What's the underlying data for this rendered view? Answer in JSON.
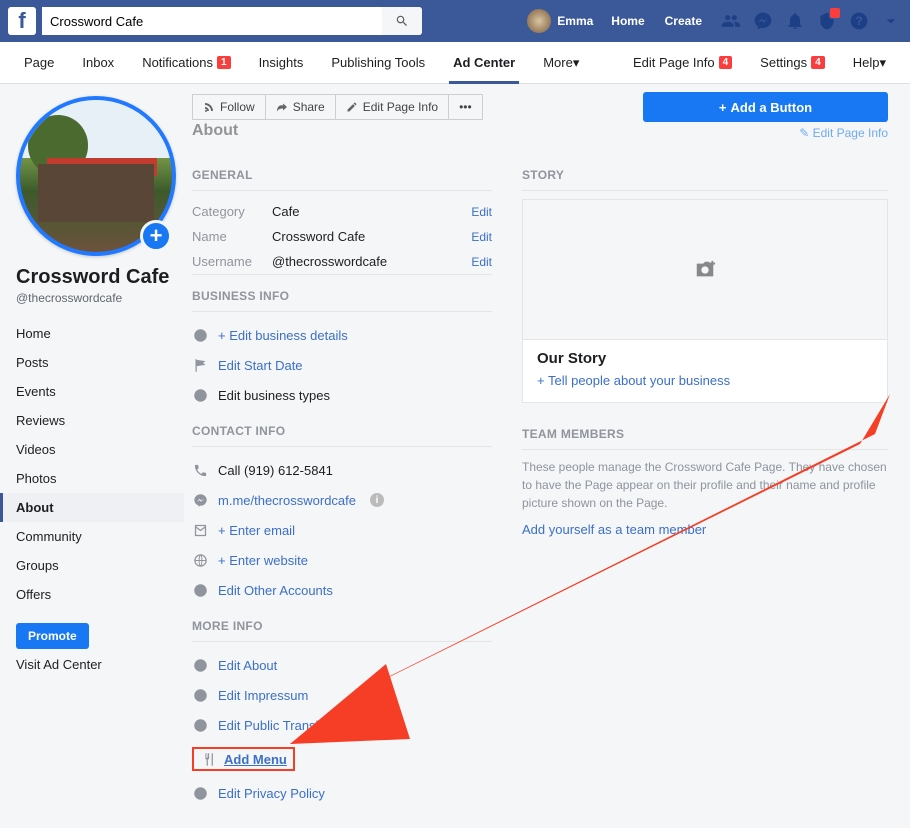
{
  "topnav": {
    "search_value": "Crossword Cafe",
    "profile_name": "Emma",
    "links": {
      "home": "Home",
      "create": "Create"
    }
  },
  "pagetabs": {
    "page": "Page",
    "inbox": "Inbox",
    "notifications": "Notifications",
    "notifications_count": "1",
    "insights": "Insights",
    "publishing": "Publishing Tools",
    "adcenter": "Ad Center",
    "more": "More",
    "editpageinfo": "Edit Page Info",
    "editpageinfo_count": "4",
    "settings": "Settings",
    "settings_count": "4",
    "help": "Help"
  },
  "left": {
    "title": "Crossword Cafe",
    "handle": "@thecrosswordcafe",
    "nav": [
      "Home",
      "Posts",
      "Events",
      "Reviews",
      "Videos",
      "Photos",
      "About",
      "Community",
      "Groups",
      "Offers"
    ],
    "nav_active": "About",
    "promote": "Promote",
    "visit": "Visit Ad Center"
  },
  "actions": {
    "follow": "Follow",
    "share": "Share",
    "editpageinfo": "Edit Page Info",
    "addbutton": "Add a Button"
  },
  "about": {
    "heading": "About",
    "edit_link": "Edit Page Info",
    "sections": {
      "general": "GENERAL",
      "business": "BUSINESS INFO",
      "contact": "CONTACT INFO",
      "more": "MORE INFO"
    },
    "general": {
      "category_label": "Category",
      "category_value": "Cafe",
      "name_label": "Name",
      "name_value": "Crossword Cafe",
      "username_label": "Username",
      "username_value": "@thecrosswordcafe",
      "edit": "Edit"
    },
    "business": {
      "edit_details": "+ Edit business details",
      "start_date": "Edit Start Date",
      "types": "Edit business types"
    },
    "contact": {
      "phone": "Call (919) 612-5841",
      "messenger": "m.me/thecrosswordcafe",
      "email": "+ Enter email",
      "website": "+ Enter website",
      "other": "Edit Other Accounts"
    },
    "more": {
      "about": "Edit About",
      "impressum": "Edit Impressum",
      "transit": "Edit Public Transit",
      "menu": "Add Menu",
      "privacy": "Edit Privacy Policy"
    }
  },
  "story": {
    "heading": "STORY",
    "title": "Our Story",
    "link": "+ Tell people about your business"
  },
  "team": {
    "heading": "TEAM MEMBERS",
    "desc": "These people manage the Crossword Cafe Page. They have chosen to have the Page appear on their profile and their name and profile picture shown on the Page.",
    "link": "Add yourself as a team member"
  }
}
